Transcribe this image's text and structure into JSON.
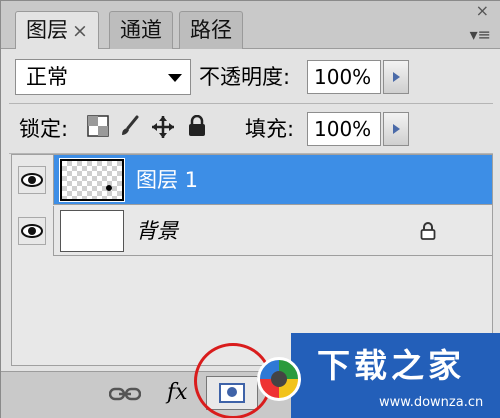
{
  "tabs": [
    {
      "label": "图层",
      "close": "×"
    },
    {
      "label": "通道"
    },
    {
      "label": "路径"
    }
  ],
  "panel_close": "×",
  "panel_menu": "▾≡",
  "blend_mode": {
    "value": "正常"
  },
  "opacity": {
    "label": "不透明度:",
    "value": "100%"
  },
  "lock": {
    "label": "锁定:"
  },
  "fill": {
    "label": "填充:",
    "value": "100%"
  },
  "layers": [
    {
      "name": "图层 1",
      "selected": true
    },
    {
      "name": "背景",
      "selected": false
    }
  ],
  "bottom": {
    "fx": "fx"
  },
  "watermark": {
    "title": "下载之家",
    "url": "www.downza.cn"
  },
  "colors": {
    "selection": "#3d8ee6",
    "annotation": "#d91c1c",
    "watermark_bg": "#235fb9"
  }
}
